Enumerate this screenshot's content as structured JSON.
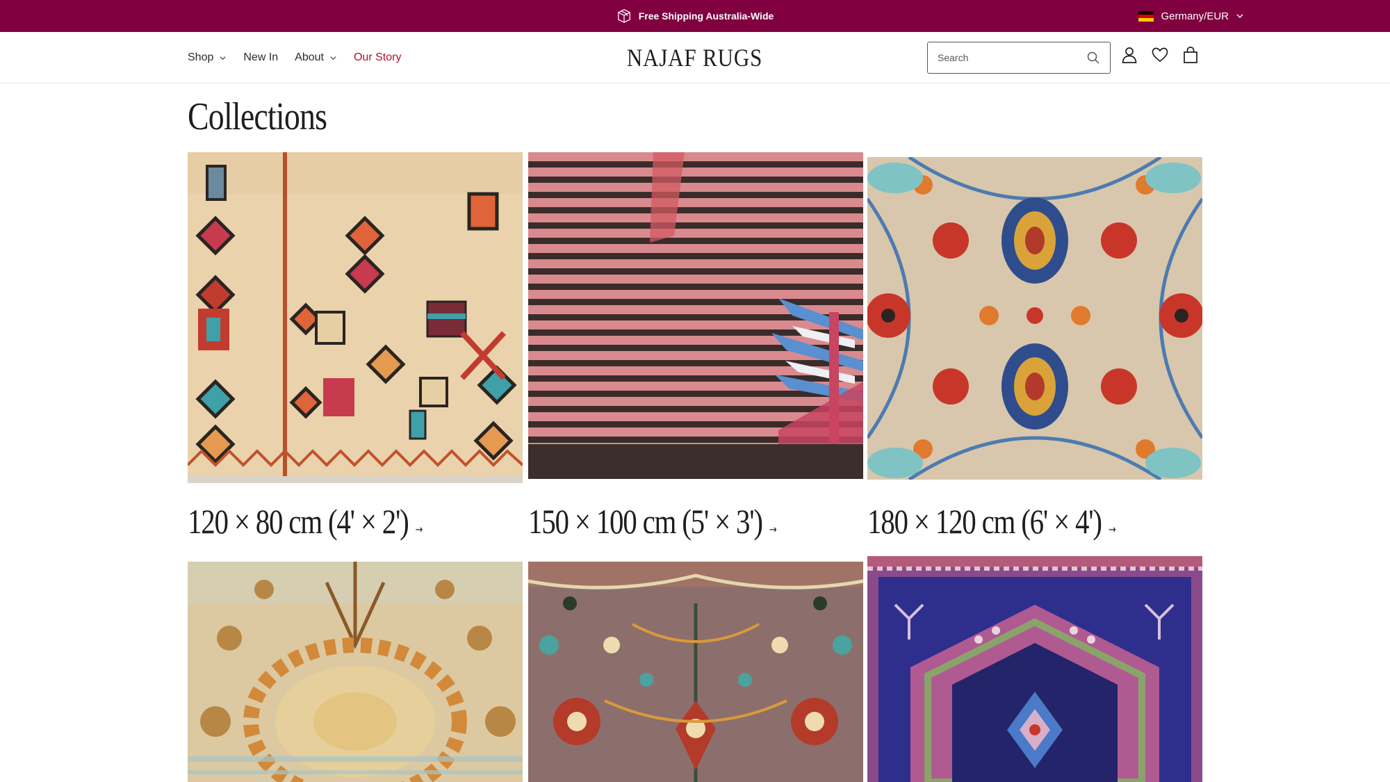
{
  "announcement": {
    "text": "Free Shipping Australia-Wide",
    "icon": "package-icon"
  },
  "locale": {
    "label": "Germany/EUR",
    "flag_colors": [
      "#000000",
      "#dd0000",
      "#ffce00"
    ]
  },
  "nav": {
    "shop": "Shop",
    "new_in": "New In",
    "about": "About",
    "our_story": "Our Story"
  },
  "brand": {
    "logo": "NAJAF RUGS"
  },
  "search": {
    "placeholder": "Search",
    "value": ""
  },
  "header_icons": [
    "account-icon",
    "wishlist-heart-icon",
    "cart-bag-icon"
  ],
  "main": {
    "title": "Collections",
    "collections": [
      {
        "label": "120 × 80 cm (4' × 2')",
        "arrow": "→"
      },
      {
        "label": "150 × 100 cm (5' × 3')",
        "arrow": "→"
      },
      {
        "label": "180 × 120 cm (6' × 4')",
        "arrow": "→"
      },
      {
        "label": "",
        "arrow": ""
      },
      {
        "label": "",
        "arrow": ""
      },
      {
        "label": "",
        "arrow": ""
      }
    ]
  },
  "colors": {
    "announcement_bg": "#800040",
    "active_link": "#b0122e"
  }
}
